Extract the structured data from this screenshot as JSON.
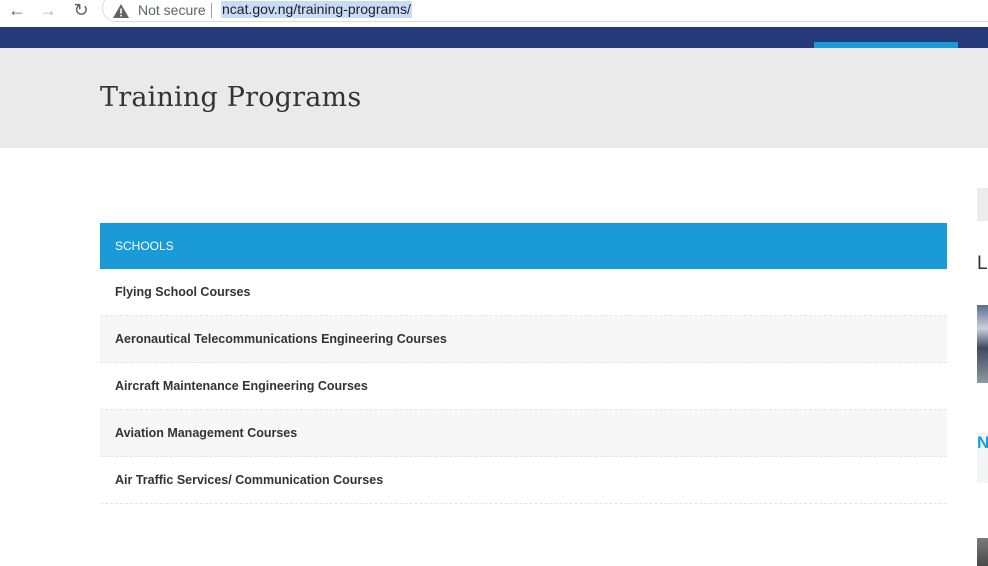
{
  "browser": {
    "back_icon": "arrow-left-icon",
    "forward_icon": "arrow-right-icon",
    "reload_icon": "reload-icon",
    "security_label": "Not secure",
    "url": "ncat.gov.ng/training-programs/"
  },
  "page": {
    "title": "Training Programs"
  },
  "schools": {
    "header": "SCHOOLS",
    "items": [
      {
        "label": "Flying School Courses"
      },
      {
        "label": "Aeronautical Telecommunications Engineering Courses"
      },
      {
        "label": "Aircraft Maintenance Engineering Courses"
      },
      {
        "label": "Aviation Management Courses"
      },
      {
        "label": "Air Traffic Services/ Communication Courses"
      }
    ]
  },
  "sidebar": {
    "heading_fragment": "L",
    "thumb_fragment": "N"
  },
  "colors": {
    "nav_bar": "#263a7b",
    "accent": "#1a9bd7",
    "title_band": "#eaeaea"
  }
}
